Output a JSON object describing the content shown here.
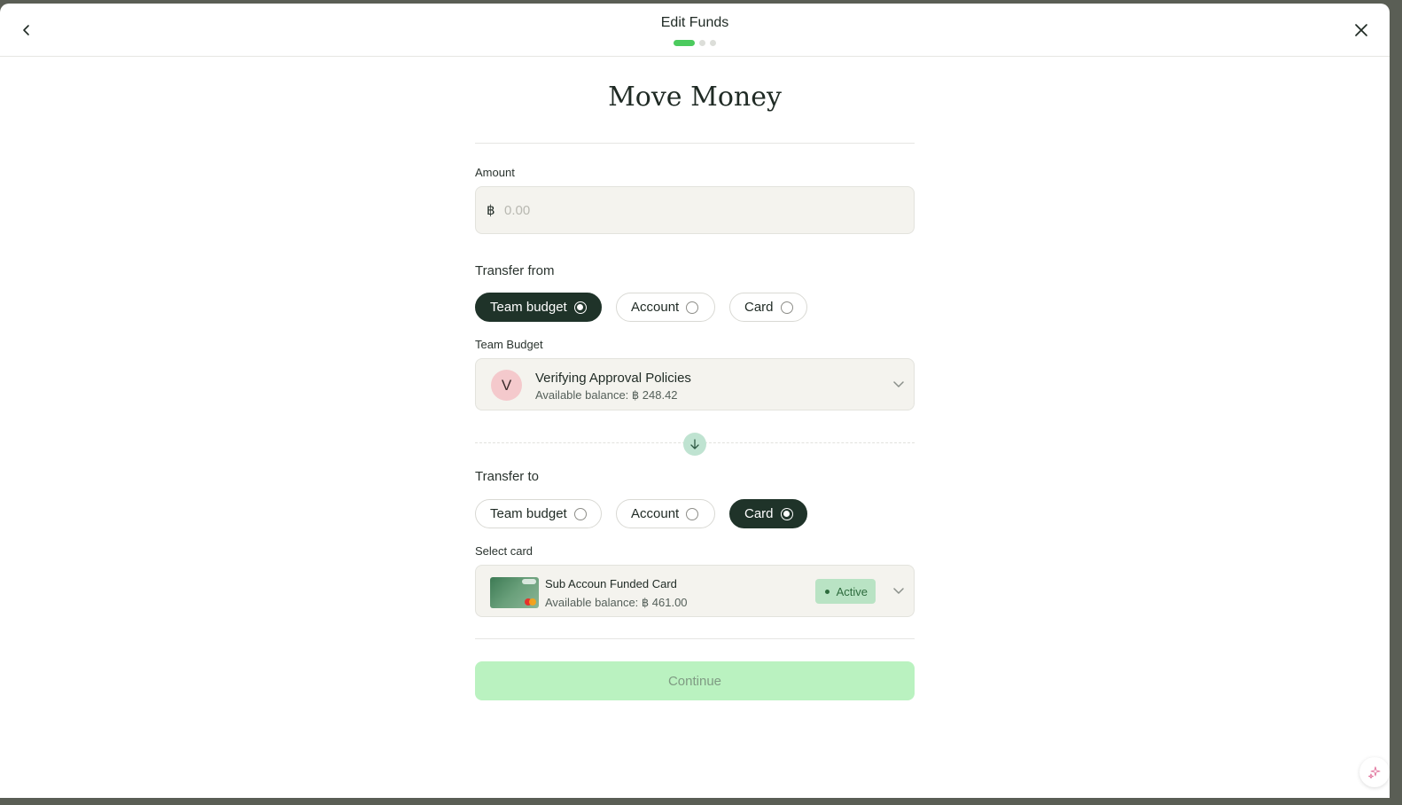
{
  "header": {
    "title": "Edit Funds",
    "back_icon": "chevron-left-icon",
    "close_icon": "close-icon",
    "steps_total": 3,
    "step_current": 1
  },
  "page": {
    "title": "Move Money"
  },
  "amount": {
    "label": "Amount",
    "currency_symbol": "฿",
    "placeholder": "0.00",
    "value": ""
  },
  "transfer_from": {
    "label": "Transfer from",
    "options": [
      "Team budget",
      "Account",
      "Card"
    ],
    "selected": "Team budget",
    "field_label": "Team Budget",
    "selection": {
      "avatar_letter": "V",
      "name": "Verifying Approval Policies",
      "balance_text": "Available balance: ฿ 248.42"
    }
  },
  "transfer_to": {
    "label": "Transfer to",
    "options": [
      "Team budget",
      "Account",
      "Card"
    ],
    "selected": "Card",
    "field_label": "Select card",
    "selection": {
      "name": "Sub Accoun Funded Card",
      "balance_text": "Available balance: ฿ 461.00",
      "status": "Active"
    }
  },
  "actions": {
    "continue_label": "Continue"
  },
  "colors": {
    "accent": "#4ccb5e",
    "selected_pill": "#1f3329",
    "continue_bg": "#baf2c0",
    "badge_bg": "#b9e3c4"
  }
}
